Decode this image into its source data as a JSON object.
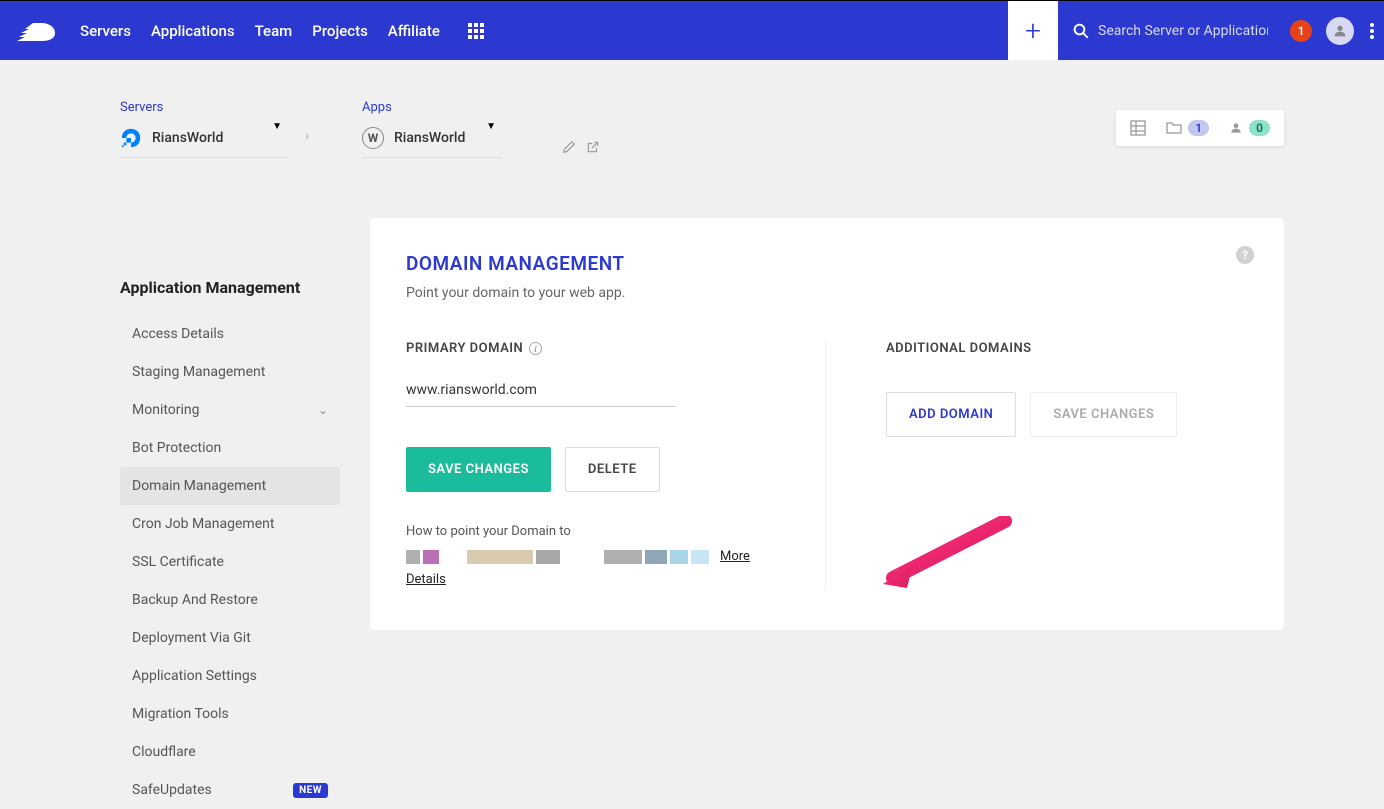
{
  "nav": {
    "items": [
      "Servers",
      "Applications",
      "Team",
      "Projects",
      "Affiliate"
    ]
  },
  "search": {
    "placeholder": "Search Server or Application"
  },
  "notifications": {
    "count": "1"
  },
  "breadcrumb": {
    "servers_label": "Servers",
    "server_name": "RiansWorld",
    "apps_label": "Apps",
    "app_name": "RiansWorld"
  },
  "stats": {
    "folder_count": "1",
    "user_count": "0"
  },
  "sidebar": {
    "title": "Application Management",
    "items": [
      {
        "label": "Access Details",
        "active": false
      },
      {
        "label": "Staging Management",
        "active": false
      },
      {
        "label": "Monitoring",
        "active": false,
        "expandable": true
      },
      {
        "label": "Bot Protection",
        "active": false
      },
      {
        "label": "Domain Management",
        "active": true
      },
      {
        "label": "Cron Job Management",
        "active": false
      },
      {
        "label": "SSL Certificate",
        "active": false
      },
      {
        "label": "Backup And Restore",
        "active": false
      },
      {
        "label": "Deployment Via Git",
        "active": false
      },
      {
        "label": "Application Settings",
        "active": false
      },
      {
        "label": "Migration Tools",
        "active": false
      },
      {
        "label": "Cloudflare",
        "active": false
      },
      {
        "label": "SafeUpdates",
        "active": false,
        "new": true
      }
    ],
    "new_badge": "NEW"
  },
  "panel": {
    "title": "DOMAIN MANAGEMENT",
    "subtitle": "Point your domain to your web app.",
    "primary_label": "PRIMARY DOMAIN",
    "domain_value": "www.riansworld.com",
    "save_label": "SAVE CHANGES",
    "delete_label": "DELETE",
    "help_text": "How to point your Domain to",
    "more_link": "More",
    "details_link": "Details",
    "additional_label": "ADDITIONAL DOMAINS",
    "add_domain_label": "ADD DOMAIN",
    "save_changes2_label": "SAVE CHANGES"
  }
}
